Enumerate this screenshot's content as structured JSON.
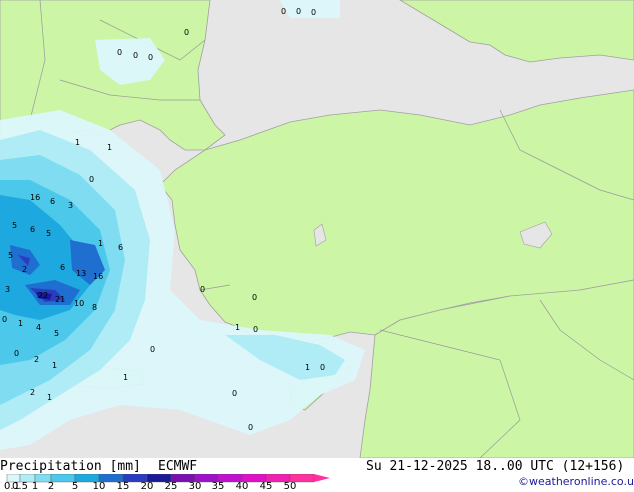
{
  "footer": {
    "title": "Precipitation [mm]",
    "model": "ECMWF",
    "valid_time": "Su 21-12-2025 18..00 UTC (12+156)",
    "credit": "©weatheronline.co.uk"
  },
  "legend": {
    "ticks": [
      "0.1",
      "0.5",
      "1",
      "2",
      "5",
      "10",
      "15",
      "20",
      "25",
      "30",
      "35",
      "40",
      "45",
      "50"
    ],
    "colors": [
      "#dcf7fb",
      "#b0ecf6",
      "#7fdcf1",
      "#4cc8ea",
      "#1ea8e0",
      "#1e6fd0",
      "#2a3cc0",
      "#1a1a99",
      "#7a10b0",
      "#a010c8",
      "#c010d0",
      "#e010c8",
      "#f020b0",
      "#ff30a0"
    ]
  },
  "map": {
    "land_color": "#ccf5a6",
    "sea_color": "#e6e6e6",
    "border_color": "#a0a0a0",
    "value_labels": [
      "0",
      "0",
      "0",
      "0",
      "0",
      "0",
      "0",
      "1",
      "1",
      "16",
      "6",
      "3",
      "0",
      "5",
      "6",
      "5",
      "1",
      "6",
      "5",
      "13",
      "16",
      "6",
      "2",
      "3",
      "22",
      "21",
      "10",
      "8",
      "0",
      "1",
      "4",
      "5",
      "0",
      "2",
      "1",
      "2",
      "1",
      "1",
      "0",
      "0",
      "0",
      "1",
      "0",
      "1",
      "0",
      "0",
      "0"
    ]
  }
}
